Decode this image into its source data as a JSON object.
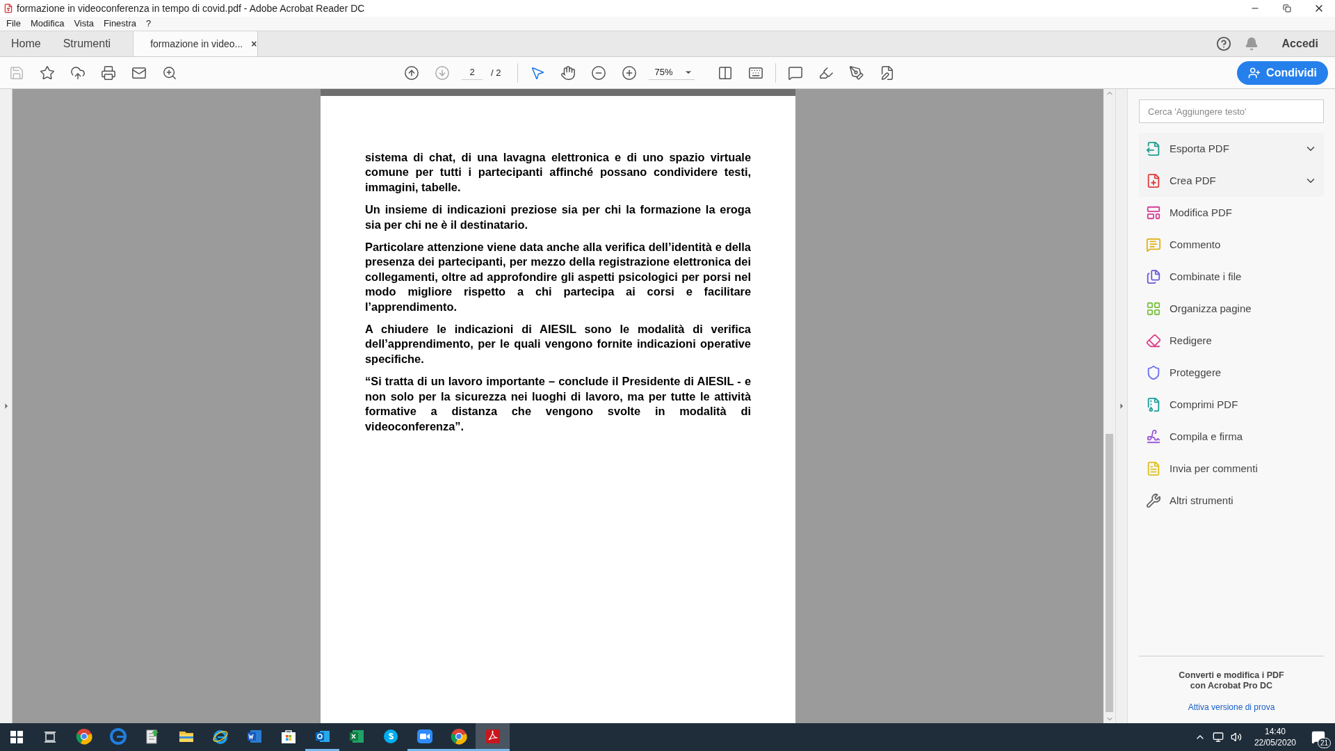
{
  "window": {
    "title": "formazione in videoconferenza in tempo di covid.pdf - Adobe Acrobat Reader DC"
  },
  "menu": [
    "File",
    "Modifica",
    "Vista",
    "Finestra",
    "?"
  ],
  "tabs": [
    {
      "label": "Home",
      "kind": "nav",
      "selected": false
    },
    {
      "label": "Strumenti",
      "kind": "nav",
      "selected": false
    },
    {
      "label": "formazione in video...",
      "kind": "document",
      "selected": true,
      "close": "×"
    }
  ],
  "header_actions": {
    "sign_in": "Accedi"
  },
  "toolbar": {
    "page": "2",
    "page_total": "/ 2",
    "zoom": "75%",
    "share_button": "Condividi"
  },
  "document": {
    "paragraphs": [
      "sistema di chat, di una lavagna elettronica e di uno spazio virtuale comune per tutti i partecipanti affinché possano condividere testi, immagini, tabelle.",
      "Un insieme di indicazioni preziose sia per chi la formazione la eroga sia per chi ne è il destinatario.",
      "Particolare attenzione viene data anche alla verifica dell’identità e della presenza dei partecipanti, per mezzo della registrazione elettronica dei collegamenti, oltre ad approfondire gli aspetti psicologici per porsi nel modo migliore rispetto a chi partecipa ai corsi e facilitare l’apprendimento.",
      "A chiudere le indicazioni di AIESIL sono le modalità di verifica dell’apprendimento, per le quali vengono fornite indicazioni operative specifiche.",
      "“Si tratta di un lavoro importante – conclude il Presidente di AIESIL - e non solo per la sicurezza nei luoghi di lavoro, ma per tutte le attività formative a distanza che vengono svolte in modalità di videoconferenza”."
    ]
  },
  "tools_panel": {
    "search": {
      "placeholder": "Cerca 'Aggiungere testo'"
    },
    "tools": [
      {
        "label": "Esporta PDF",
        "kind": "export",
        "color": "#1e9e8f",
        "expandable": true
      },
      {
        "label": "Crea PDF",
        "kind": "create",
        "color": "#e23c3c",
        "expandable": true
      },
      {
        "label": "Modifica PDF",
        "kind": "edit",
        "color": "#d63d96",
        "expandable": false
      },
      {
        "label": "Commento",
        "kind": "comment",
        "color": "#e0b31d",
        "expandable": false
      },
      {
        "label": "Combinate i file",
        "kind": "combine",
        "color": "#6a5be0",
        "expandable": false
      },
      {
        "label": "Organizza pagine",
        "kind": "organize",
        "color": "#7ac142",
        "expandable": false
      },
      {
        "label": "Redigere",
        "kind": "redact",
        "color": "#e0408a",
        "expandable": false
      },
      {
        "label": "Proteggere",
        "kind": "protect",
        "color": "#6c6ff0",
        "expandable": false
      },
      {
        "label": "Comprimi PDF",
        "kind": "compress",
        "color": "#1a9e9e",
        "expandable": false
      },
      {
        "label": "Compila e firma",
        "kind": "sign",
        "color": "#9a58d6",
        "expandable": false
      },
      {
        "label": "Invia per commenti",
        "kind": "send",
        "color": "#e0c01d",
        "expandable": false
      },
      {
        "label": "Altri strumenti",
        "kind": "more",
        "color": "#666666",
        "expandable": false
      }
    ],
    "promo": {
      "text": "Converti e modifica i PDF con Acrobat Pro DC",
      "link": "Attiva versione di prova"
    }
  },
  "taskbar": {
    "apps": [
      {
        "kind": "chrome",
        "running": false,
        "selected": false
      },
      {
        "kind": "edge",
        "running": false,
        "selected": false
      },
      {
        "kind": "notes",
        "running": false,
        "selected": false
      },
      {
        "kind": "folder",
        "running": false,
        "selected": false
      },
      {
        "kind": "ie",
        "running": false,
        "selected": false
      },
      {
        "kind": "word",
        "running": false,
        "selected": false
      },
      {
        "kind": "store",
        "running": false,
        "selected": false
      },
      {
        "kind": "outlook",
        "running": true,
        "selected": false
      },
      {
        "kind": "excel",
        "running": false,
        "selected": false
      },
      {
        "kind": "skype",
        "running": false,
        "selected": false
      },
      {
        "kind": "zoom",
        "running": true,
        "selected": false
      },
      {
        "kind": "chrome",
        "running": true,
        "selected": false
      },
      {
        "kind": "acrobat",
        "running": true,
        "selected": true
      }
    ],
    "time": "14:40",
    "date": "22/05/2020",
    "notifications": "21"
  }
}
